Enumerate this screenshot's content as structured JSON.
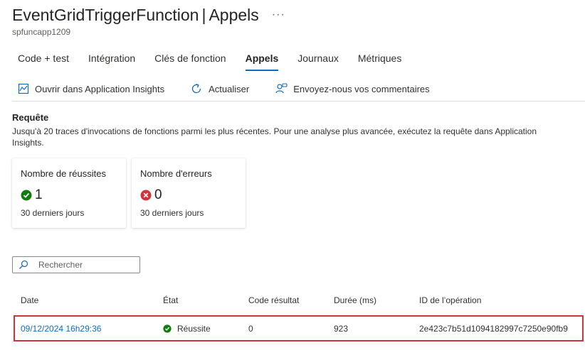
{
  "header": {
    "title": "EventGridTriggerFunction",
    "separator": "|",
    "section": "Appels",
    "more": "···",
    "subtitle": "spfuncapp1209"
  },
  "tabs": [
    {
      "label": "Code + test",
      "active": false
    },
    {
      "label": "Intégration",
      "active": false
    },
    {
      "label": "Clés de fonction",
      "active": false
    },
    {
      "label": "Appels",
      "active": true
    },
    {
      "label": "Journaux",
      "active": false
    },
    {
      "label": "Métriques",
      "active": false
    }
  ],
  "toolbar": {
    "open_insights": "Ouvrir dans Application Insights",
    "refresh": "Actualiser",
    "feedback": "Envoyez-nous vos commentaires"
  },
  "query": {
    "title": "Requête",
    "description": "Jusqu'à 20 traces d'invocations de fonctions parmi les plus récentes. Pour une analyse plus avancée, exécutez la requête dans Application Insights."
  },
  "cards": {
    "success": {
      "title": "Nombre de réussites",
      "value": "1",
      "period": "30 derniers jours",
      "icon": "check-circle-icon",
      "color": "#107c10"
    },
    "errors": {
      "title": "Nombre d'erreurs",
      "value": "0",
      "period": "30 derniers jours",
      "icon": "error-circle-icon",
      "color": "#d13438"
    }
  },
  "search": {
    "placeholder": "Rechercher",
    "icon": "search-icon"
  },
  "table": {
    "columns": [
      "Date",
      "État",
      "Code résultat",
      "Durée (ms)",
      "ID de l’opération"
    ],
    "rows": [
      {
        "date": "09/12/2024 16h29:36",
        "status": "Réussite",
        "code": "0",
        "duration": "923",
        "operation_id": "2e423c7b51d1094182997c7250e90fb9"
      }
    ]
  },
  "colors": {
    "accent": "#0f6cbd",
    "highlight_border": "#d13438"
  }
}
